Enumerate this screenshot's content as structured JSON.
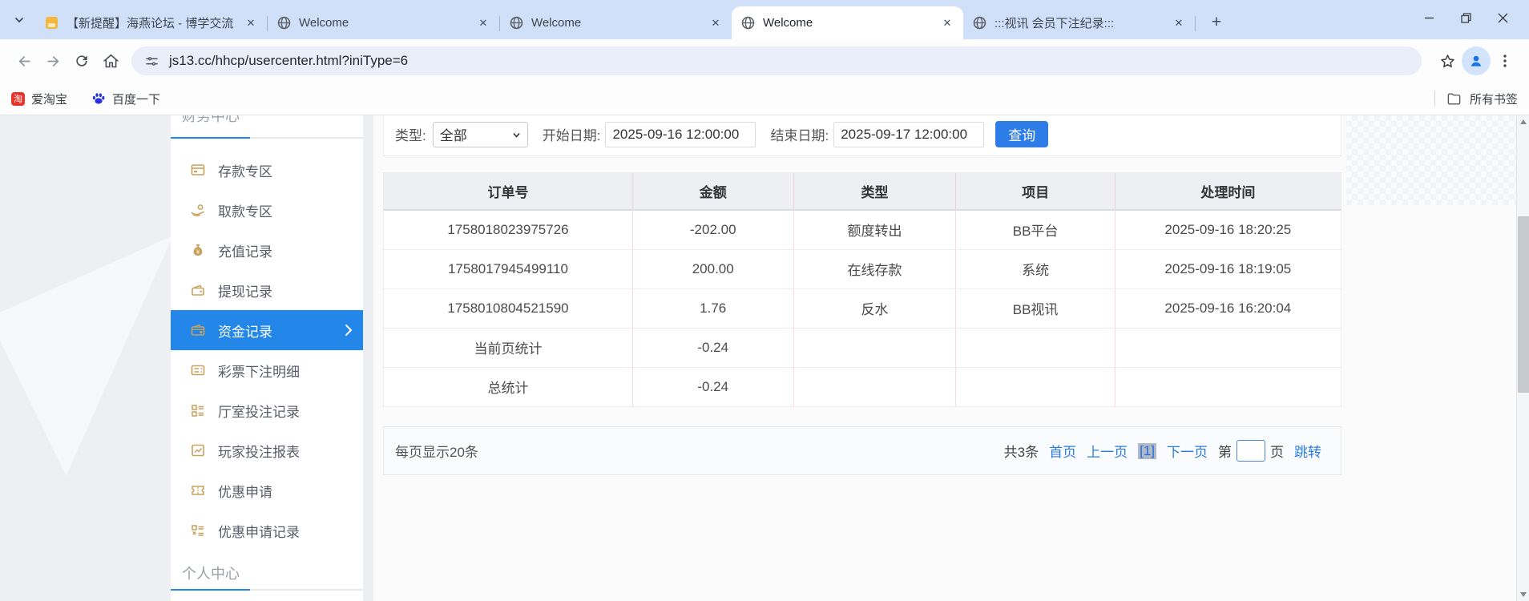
{
  "browser": {
    "tabs": [
      {
        "title": "【新提醒】海燕论坛 - 博学交流",
        "favicon": "forum",
        "active": false
      },
      {
        "title": "Welcome",
        "favicon": "globe",
        "active": false
      },
      {
        "title": "Welcome",
        "favicon": "globe",
        "active": false
      },
      {
        "title": "Welcome",
        "favicon": "globe",
        "active": true
      },
      {
        "title": ":::视讯 会员下注纪录:::",
        "favicon": "globe",
        "active": false
      }
    ],
    "url": "js13.cc/hhcp/usercenter.html?iniType=6",
    "bookmarks": [
      {
        "label": "爱淘宝",
        "icon": "taobao-icon",
        "icon_glyph": "淘"
      },
      {
        "label": "百度一下",
        "icon": "baidu-paw-icon"
      }
    ],
    "all_bookmarks_label": "所有书签"
  },
  "sidebar": {
    "section_top": "财务中心",
    "section_bottom": "个人中心",
    "items": [
      {
        "label": "存款专区",
        "icon": "deposit-card-icon",
        "active": false
      },
      {
        "label": "取款专区",
        "icon": "withdraw-hand-icon",
        "active": false
      },
      {
        "label": "充值记录",
        "icon": "money-bag-icon",
        "active": false
      },
      {
        "label": "提现记录",
        "icon": "wallet-icon",
        "active": false
      },
      {
        "label": "资金记录",
        "icon": "funds-record-icon",
        "active": true
      },
      {
        "label": "彩票下注明细",
        "icon": "lottery-detail-icon",
        "active": false
      },
      {
        "label": "厅室投注记录",
        "icon": "hall-bet-record-icon",
        "active": false
      },
      {
        "label": "玩家投注报表",
        "icon": "player-report-icon",
        "active": false
      },
      {
        "label": "优惠申请",
        "icon": "promo-apply-icon",
        "active": false
      },
      {
        "label": "优惠申请记录",
        "icon": "promo-record-icon",
        "active": false
      }
    ]
  },
  "filters": {
    "type_label": "类型:",
    "type_value": "全部",
    "start_label": "开始日期:",
    "start_value": "2025-09-16 12:00:00",
    "end_label": "结束日期:",
    "end_value": "2025-09-17 12:00:00",
    "search_button": "查询"
  },
  "table": {
    "columns": [
      "订单号",
      "金额",
      "类型",
      "项目",
      "处理时间"
    ],
    "rows": [
      [
        "1758018023975726",
        "-202.00",
        "额度转出",
        "BB平台",
        "2025-09-16 18:20:25"
      ],
      [
        "1758017945499110",
        "200.00",
        "在线存款",
        "系统",
        "2025-09-16 18:19:05"
      ],
      [
        "1758010804521590",
        "1.76",
        "反水",
        "BB视讯",
        "2025-09-16 16:20:04"
      ],
      [
        "当前页统计",
        "-0.24",
        "",
        "",
        ""
      ],
      [
        "总统计",
        "-0.24",
        "",
        "",
        ""
      ]
    ]
  },
  "pagination": {
    "page_size_text": "每页显示20条",
    "total_text": "共3条",
    "first_label": "首页",
    "prev_label": "上一页",
    "current_label": "[1]",
    "next_label": "下一页",
    "jump_prefix": "第",
    "jump_suffix": "页",
    "jump_button": "跳转"
  },
  "colors": {
    "tabstrip_bg": "#d0e0f9",
    "active_menu_blue": "#2287e8",
    "button_blue": "#2e7ce8",
    "link_blue": "#2a7ce0",
    "gold_icon": "#c9a15e",
    "table_header_bg": "#edeff3",
    "cell_divider_pink": "#f2dcdc"
  }
}
